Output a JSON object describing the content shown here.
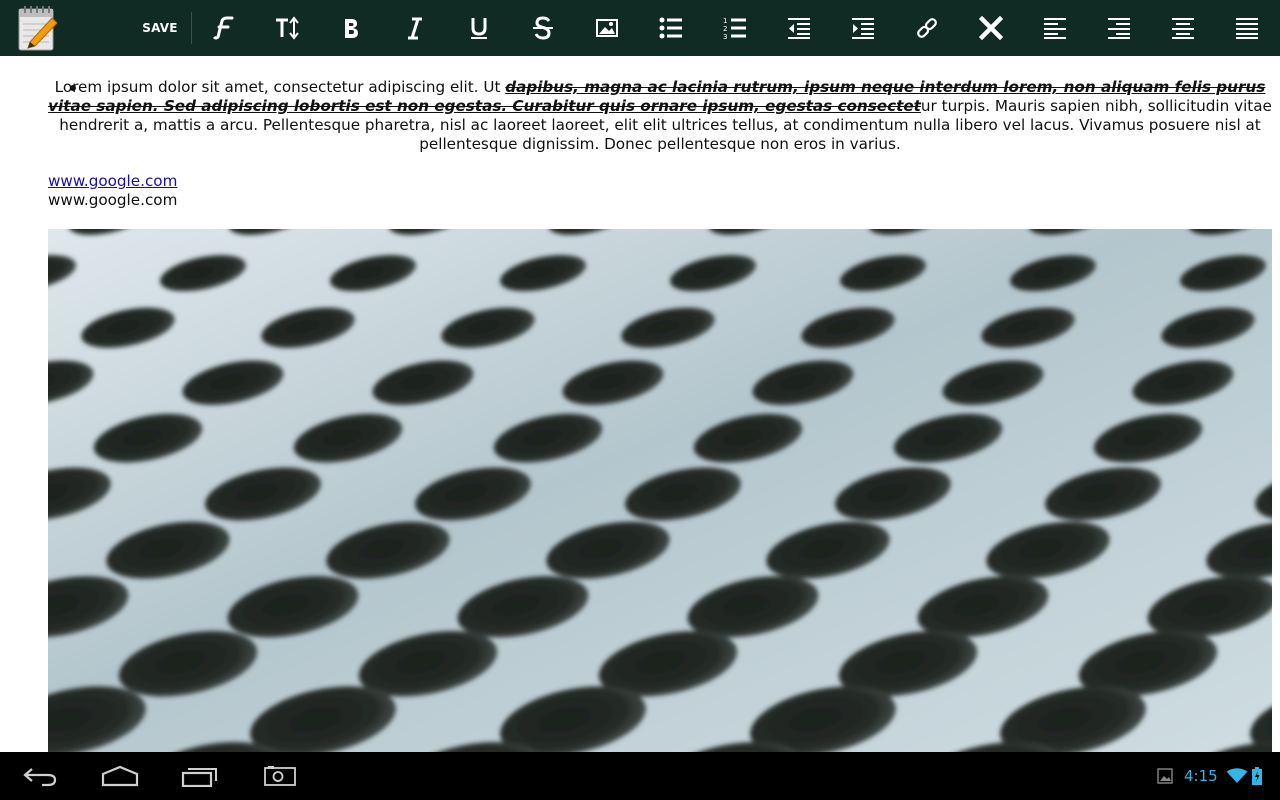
{
  "toolbar": {
    "save_label": "SAVE",
    "buttons": [
      "font-family-icon",
      "text-size-icon",
      "bold-icon",
      "italic-icon",
      "underline-icon",
      "strikethrough-icon",
      "insert-image-icon",
      "bulleted-list-icon",
      "numbered-list-icon",
      "outdent-icon",
      "indent-icon",
      "link-icon",
      "remove-format-icon",
      "align-left-icon",
      "align-right-icon",
      "align-center-icon",
      "justify-icon"
    ],
    "background": "#0f2b24"
  },
  "document": {
    "bullet_text_before": "Lorem ipsum dolor sit amet, consectetur adipiscing elit. Ut ",
    "bullet_text_strike": "dapibus, magna ac lacinia rutrum, ipsum neque interdum lorem, non aliquam felis purus vitae sapien. Sed adipiscing lobortis est non egestas. Curabitur quis ornare ipsum, egestas consectet",
    "bullet_text_after": "ur turpis. Mauris sapien nibh, sollicitudin vitae hendrerit a, mattis a arcu. Pellentesque pharetra, nisl ac laoreet laoreet, elit elit ultrices tellus, at condimentum nulla libero vel lacus. Vivamus posuere nisl at pellentesque dignissim. Donec pellentesque non eros in varius.",
    "link_text": "www.google.com",
    "plain_text": "www.google.com"
  },
  "navbar": {
    "buttons": [
      "back-icon",
      "home-icon",
      "recent-apps-icon",
      "screenshot-icon"
    ],
    "time": "4:15",
    "accent": "#33b5e5"
  }
}
